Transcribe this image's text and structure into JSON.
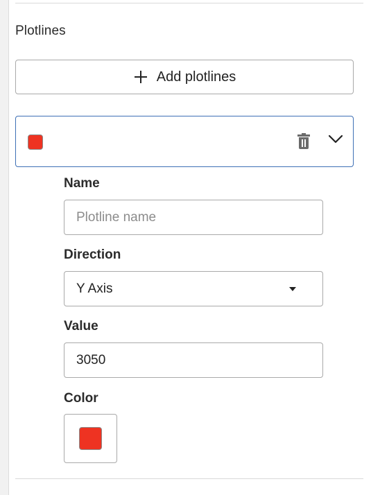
{
  "section": {
    "title": "Plotlines",
    "add_button_label": "Add plotlines"
  },
  "plotline": {
    "color": "#ee3322",
    "name_label": "Name",
    "name_value": "",
    "name_placeholder": "Plotline name",
    "direction_label": "Direction",
    "direction_value": "Y Axis",
    "value_label": "Value",
    "value_value": "3050",
    "color_label": "Color"
  },
  "icons": {
    "add": "plus-icon",
    "delete": "trash-icon",
    "expand": "chevron-down-icon",
    "dropdown": "caret-down-icon"
  },
  "colors": {
    "accent_border": "#3d6fb5",
    "plotline_color": "#ee3322"
  }
}
